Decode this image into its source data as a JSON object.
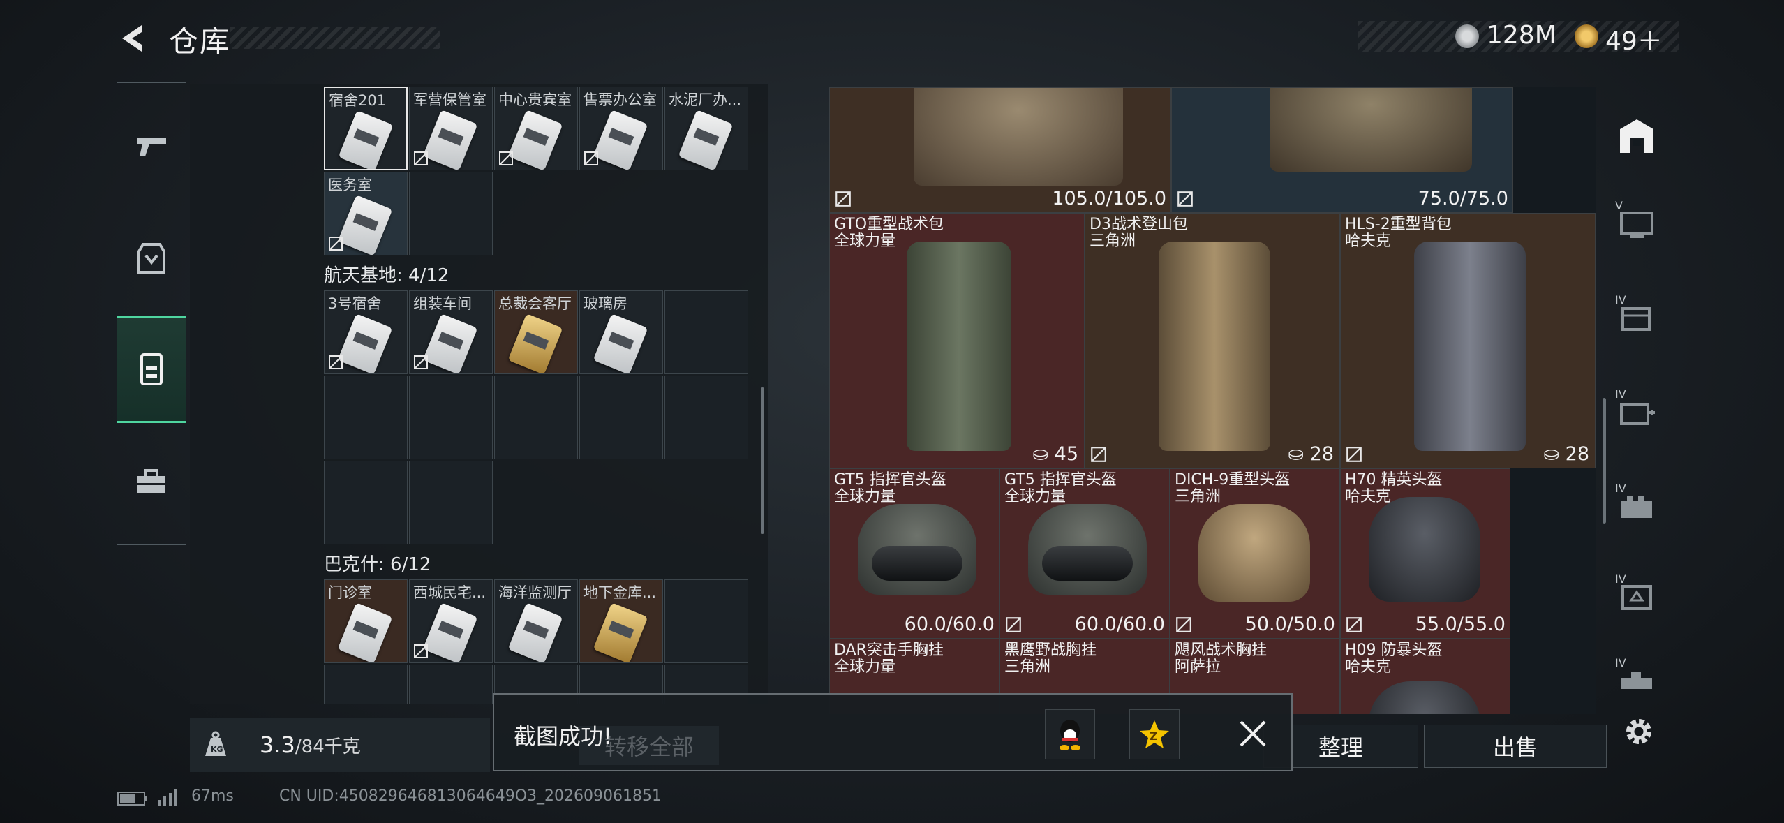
{
  "header": {
    "title": "仓库",
    "currency_1": "128M",
    "currency_2": "49＋"
  },
  "nav": {
    "items": [
      {
        "name": "pistol-icon"
      },
      {
        "name": "chest-rig-icon"
      },
      {
        "name": "backpack-icon"
      },
      {
        "name": "toolbox-icon"
      }
    ]
  },
  "keys": {
    "row1": [
      "宿舍201",
      "军营保管室",
      "中心贵宾室",
      "售票办公室",
      "水泥厂办..."
    ],
    "row2": [
      "医务室"
    ],
    "section2_title": "航天基地: 4/12",
    "section2": [
      "3号宿舍",
      "组装车间",
      "总裁会客厅",
      "玻璃房"
    ],
    "section3_title": "巴克什: 6/12",
    "section3": [
      "门诊室",
      "西城民宅...",
      "海洋监测厅",
      "地下金库..."
    ]
  },
  "weight": {
    "current": "3.3",
    "max": "/84千克"
  },
  "items": {
    "top_left_durability": "105.0/105.0",
    "top_right_durability": "75.0/75.0",
    "backpacks": [
      {
        "name": "GTO重型战术包",
        "maker": "全球力量",
        "count": "45"
      },
      {
        "name": "D3战术登山包",
        "maker": "三角洲",
        "count": "28"
      },
      {
        "name": "HLS-2重型背包",
        "maker": "哈夫克",
        "count": "28"
      }
    ],
    "helmets": [
      {
        "name": "GT5 指挥官头盔",
        "maker": "全球力量",
        "durability": "60.0/60.0"
      },
      {
        "name": "GT5 指挥官头盔",
        "maker": "全球力量",
        "durability": "60.0/60.0"
      },
      {
        "name": "DICH-9重型头盔",
        "maker": "三角洲",
        "durability": "50.0/50.0"
      },
      {
        "name": "H70 精英头盔",
        "maker": "哈夫克",
        "durability": "55.0/55.0"
      }
    ],
    "row4": [
      {
        "name": "DAR突击手胸挂",
        "maker": "全球力量"
      },
      {
        "name": "黑鹰野战胸挂",
        "maker": "三角洲"
      },
      {
        "name": "飓风战术胸挂",
        "maker": "阿萨拉"
      },
      {
        "name": "H09 防暴头盔",
        "maker": "哈夫克"
      }
    ]
  },
  "right_tools": [
    {
      "tier": "",
      "name": "storage-icon"
    },
    {
      "tier": "V",
      "name": "computer-icon"
    },
    {
      "tier": "IV",
      "name": "files-icon"
    },
    {
      "tier": "IV",
      "name": "medical-icon"
    },
    {
      "tier": "IV",
      "name": "ammo-box-icon"
    },
    {
      "tier": "IV",
      "name": "armor-icon"
    },
    {
      "tier": "IV",
      "name": "gun-case-icon"
    }
  ],
  "buttons": {
    "transfer_all": "转移全部",
    "organize": "整理",
    "sell": "出售"
  },
  "toast": {
    "message": "截图成功!"
  },
  "footer": {
    "ping": "67ms",
    "uid": "CN UID:450829646813064649O3_202609061851"
  }
}
